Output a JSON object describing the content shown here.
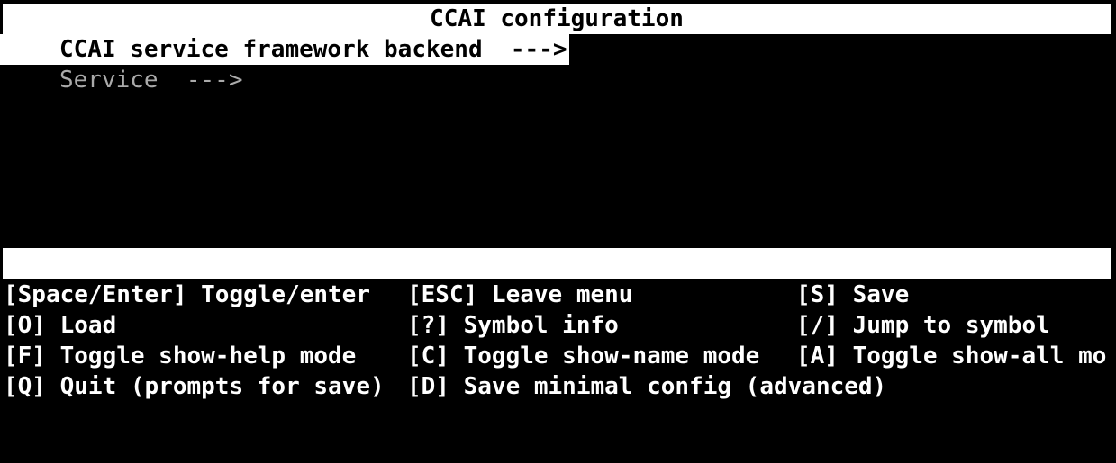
{
  "title": "CCAI configuration",
  "menu": {
    "items": [
      {
        "label": "CCAI service framework backend  --->",
        "selected": true
      },
      {
        "label": "Service  --->",
        "selected": false
      }
    ]
  },
  "help": {
    "rows": [
      [
        "[Space/Enter] Toggle/enter",
        "[ESC] Leave menu",
        "[S] Save"
      ],
      [
        "[O] Load",
        "[?] Symbol info",
        "[/] Jump to symbol"
      ],
      [
        "[F] Toggle show-help mode",
        "[C] Toggle show-name mode",
        "[A] Toggle show-all mo"
      ],
      [
        "[Q] Quit (prompts for save)",
        "[D] Save minimal config (advanced)",
        ""
      ]
    ]
  }
}
